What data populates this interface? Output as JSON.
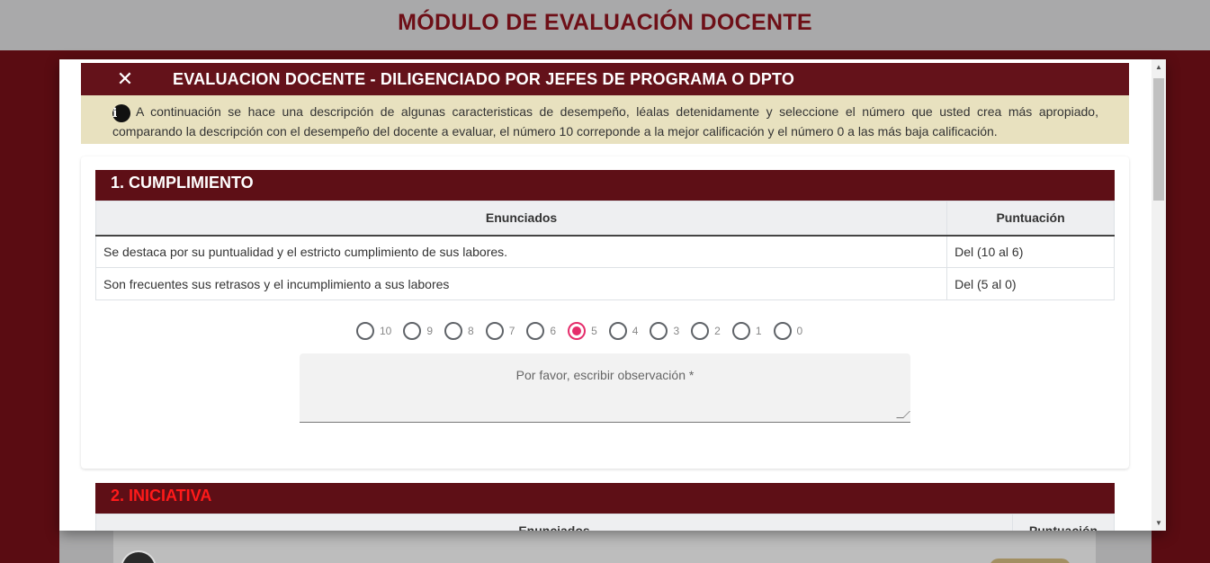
{
  "page": {
    "title": "MÓDULO DE EVALUACIÓN DOCENTE"
  },
  "modal": {
    "close_icon": "close-icon",
    "title": "EVALUACION DOCENTE - DILIGENCIADO POR JEFES DE PROGRAMA O DPTO",
    "info_icon": "info-icon",
    "info_text": "A continuación se hace una descripción de algunas caracteristicas de desempeño, léalas detenidamente y seleccione el número que usted crea más apropiado, comparando la descripción con el desempeño del docente a evaluar, el número 10 correponde a la mejor calificación y el número 0 a las más baja calificación."
  },
  "sections": [
    {
      "title": "1. CUMPLIMIENTO",
      "title_color": "#ffffff",
      "columns": [
        "Enunciados",
        "Puntuación"
      ],
      "rows": [
        [
          "Se destaca por su puntualidad y el estricto cumplimiento de sus labores.",
          "Del (10 al 6)"
        ],
        [
          "Son frecuentes sus retrasos y el incumplimiento a sus labores",
          "Del (5 al 0)"
        ]
      ],
      "score_options": [
        "10",
        "9",
        "8",
        "7",
        "6",
        "5",
        "4",
        "3",
        "2",
        "1",
        "0"
      ],
      "selected_score": "5",
      "observation_placeholder": "Por favor, escribir observación *",
      "observation_value": ""
    },
    {
      "title": "2. INICIATIVA",
      "title_color": "#ff1a1a",
      "columns": [
        "Enunciados",
        "Puntuación"
      ]
    }
  ],
  "colors": {
    "brand_dark": "#5e0f16",
    "topbar": "#a9a9aa",
    "info_bg": "#e8e1bf",
    "radio_selected": "#e52d6b"
  }
}
